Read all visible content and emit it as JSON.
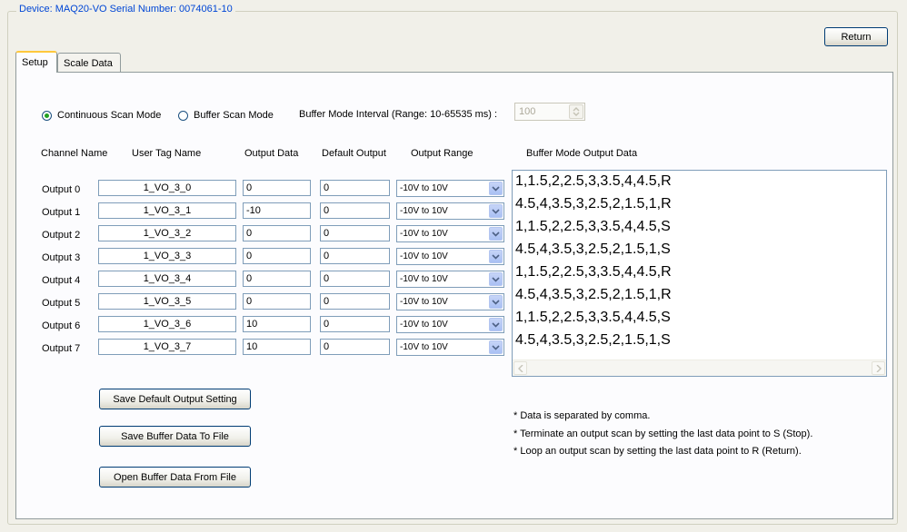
{
  "device": {
    "legend": "Device: MAQ20-VO   Serial Number: 0074061-10"
  },
  "return_button": "Return",
  "tabs": [
    {
      "label": "Setup",
      "active": true
    },
    {
      "label": "Scale Data",
      "active": false
    }
  ],
  "scan_mode": {
    "continuous_label": "Continuous Scan Mode",
    "buffer_label": "Buffer Scan Mode",
    "selected": "continuous",
    "interval_label": "Buffer Mode Interval (Range: 10-65535 ms) :",
    "interval_value": "100"
  },
  "headers": {
    "channel_name": "Channel Name",
    "user_tag": "User Tag Name",
    "output_data": "Output Data",
    "default_output": "Default Output",
    "output_range": "Output Range",
    "buffer_data": "Buffer Mode Output Data"
  },
  "channels": [
    {
      "name": "Output 0",
      "tag": "1_VO_3_0",
      "output": "0",
      "default": "0",
      "range": "-10V to 10V"
    },
    {
      "name": "Output 1",
      "tag": "1_VO_3_1",
      "output": "-10",
      "default": "0",
      "range": "-10V to 10V"
    },
    {
      "name": "Output 2",
      "tag": "1_VO_3_2",
      "output": "0",
      "default": "0",
      "range": "-10V to 10V"
    },
    {
      "name": "Output 3",
      "tag": "1_VO_3_3",
      "output": "0",
      "default": "0",
      "range": "-10V to 10V"
    },
    {
      "name": "Output 4",
      "tag": "1_VO_3_4",
      "output": "0",
      "default": "0",
      "range": "-10V to 10V"
    },
    {
      "name": "Output 5",
      "tag": "1_VO_3_5",
      "output": "0",
      "default": "0",
      "range": "-10V to 10V"
    },
    {
      "name": "Output 6",
      "tag": "1_VO_3_6",
      "output": "10",
      "default": "0",
      "range": "-10V to 10V"
    },
    {
      "name": "Output 7",
      "tag": "1_VO_3_7",
      "output": "10",
      "default": "0",
      "range": "-10V to 10V"
    }
  ],
  "buffer_lines": [
    "1,1.5,2,2.5,3,3.5,4,4.5,R",
    "4.5,4,3.5,3,2.5,2,1.5,1,R",
    "1,1.5,2,2.5,3,3.5,4,4.5,S",
    "4.5,4,3.5,3,2.5,2,1.5,1,S",
    "1,1.5,2,2.5,3,3.5,4,4.5,R",
    "4.5,4,3.5,3,2.5,2,1.5,1,R",
    "1,1.5,2,2.5,3,3.5,4,4.5,S",
    "4.5,4,3.5,3,2.5,2,1.5,1,S"
  ],
  "buttons": {
    "save_default": "Save Default Output Setting",
    "save_buffer": "Save Buffer Data To File",
    "open_buffer": "Open Buffer Data From File"
  },
  "notes": [
    "* Data is separated by comma.",
    "* Terminate an output scan by setting the last data point to S (Stop).",
    "* Loop an output scan by setting the last data point to R (Return)."
  ],
  "colors": {
    "legend_text": "#0046d5",
    "radio_selected": "#21a121",
    "tab_highlight": "#ffc83c"
  }
}
